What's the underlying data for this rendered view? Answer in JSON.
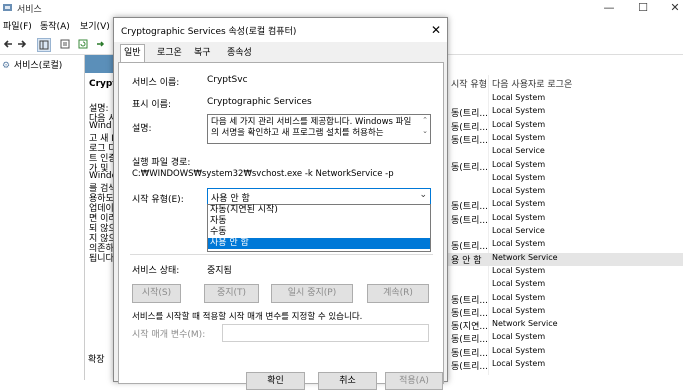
{
  "main": {
    "title": "서비스",
    "menu": [
      "파일(F)",
      "동작(A)",
      "보기(V)"
    ],
    "tree_root": "서비스(로컬)",
    "center_title": "Crypto",
    "center_desc_lines": [
      "설명:",
      "다음 서",
      "Wind",
      "고 새 I",
      "로그 다",
      "트 인증",
      "가 및",
      "Windo",
      "를 검색",
      "용하도",
      "업데이",
      "면 이러",
      "되 않으",
      "지 않으",
      "의존하",
      "됩니다"
    ],
    "ext_tab": "확장",
    "right_header": "다음 사용자로 로그온",
    "right_header_partial": "시작 유형",
    "rows": [
      {
        "c1": "",
        "c2": "",
        "c3": "Local System"
      },
      {
        "c1": "",
        "c2": "동(트리...",
        "c3": "Local System"
      },
      {
        "c1": "",
        "c2": "동(트리...",
        "c3": "Local System"
      },
      {
        "c1": "",
        "c2": "동(트리...",
        "c3": "Local System"
      },
      {
        "c1": "",
        "c2": "",
        "c3": "Local Service"
      },
      {
        "c1": "",
        "c2": "동(트리...",
        "c3": "Local System"
      },
      {
        "c1": "",
        "c2": "",
        "c3": "Local System"
      },
      {
        "c1": "",
        "c2": "",
        "c3": "Local System"
      },
      {
        "c1": "",
        "c2": "동(트리...",
        "c3": "Local System"
      },
      {
        "c1": "",
        "c2": "동(트리...",
        "c3": "Local System"
      },
      {
        "c1": "",
        "c2": "",
        "c3": "Local Service"
      },
      {
        "c1": "",
        "c2": "동(트리...",
        "c3": "Local System"
      },
      {
        "c1": "",
        "c2": "용 안 함",
        "c3": "Network Service"
      },
      {
        "c1": "",
        "c2": "",
        "c3": "Local System"
      },
      {
        "c1": "",
        "c2": "",
        "c3": "Local System"
      },
      {
        "c1": "",
        "c2": "동(트리...",
        "c3": "Local System"
      },
      {
        "c1": "",
        "c2": "동(트리...",
        "c3": "Local System"
      },
      {
        "c1": "",
        "c2": "동(지연...",
        "c3": "Network Service"
      },
      {
        "c1": "",
        "c2": "동(트리...",
        "c3": "Local System"
      },
      {
        "c1": "",
        "c2": "동(트리...",
        "c3": "Local System"
      },
      {
        "c1": "",
        "c2": "동(트리...",
        "c3": "Local System"
      }
    ]
  },
  "dialog": {
    "title": "Cryptographic Services 속성(로컬 컴퓨터)",
    "tabs": [
      "일반",
      "로그온",
      "복구",
      "종속성"
    ],
    "service_name_label": "서비스 이름:",
    "service_name": "CryptSvc",
    "display_name_label": "표시 이름:",
    "display_name": "Cryptographic Services",
    "description_label": "설명:",
    "description": "다음 세 가지 관리 서비스를 제공합니다. Windows 파일의 서명을 확인하고 새 프로그램 설치를 허용하는",
    "path_label": "실행 파일 경로:",
    "path": "C:₩WINDOWS₩system32₩svchost.exe -k NetworkService -p",
    "startup_label": "시작 유형(E):",
    "startup_value": "사용 안 함",
    "startup_options": [
      "자동(지연된 시작)",
      "자동",
      "수동",
      "사용 안 함"
    ],
    "selected_option_index": 3,
    "status_label": "서비스 상태:",
    "status_value": "중지됨",
    "buttons": [
      "시작(S)",
      "중지(T)",
      "일시 중지(P)",
      "계속(R)"
    ],
    "hint": "서비스를 시작할 때 적용할 시작 매개 변수를 지정할 수 있습니다.",
    "param_label": "시작 매개 변수(M):",
    "param_value": "",
    "bottom_buttons": [
      "확인",
      "취소",
      "적용(A)"
    ]
  }
}
